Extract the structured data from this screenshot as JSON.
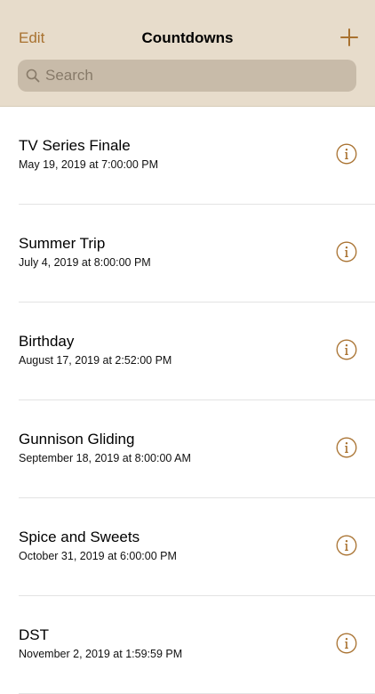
{
  "header": {
    "edit_label": "Edit",
    "title": "Countdowns",
    "add_icon": "plus-icon"
  },
  "search": {
    "placeholder": "Search",
    "icon": "magnifying-glass-icon"
  },
  "countdowns": [
    {
      "name": "TV Series Finale",
      "date": "May 19, 2019 at 7:00:00 PM"
    },
    {
      "name": "Summer Trip",
      "date": "July 4, 2019 at 8:00:00 PM"
    },
    {
      "name": "Birthday",
      "date": "August 17, 2019 at 2:52:00 PM"
    },
    {
      "name": "Gunnison Gliding",
      "date": "September 18, 2019 at 8:00:00 AM"
    },
    {
      "name": "Spice and Sweets",
      "date": "October 31, 2019 at 6:00:00 PM"
    },
    {
      "name": "DST",
      "date": "November 2, 2019 at 1:59:59 PM"
    }
  ],
  "colors": {
    "accent": "#a8712f",
    "nav_background": "#e7dccb",
    "search_background": "#c8bba9"
  }
}
